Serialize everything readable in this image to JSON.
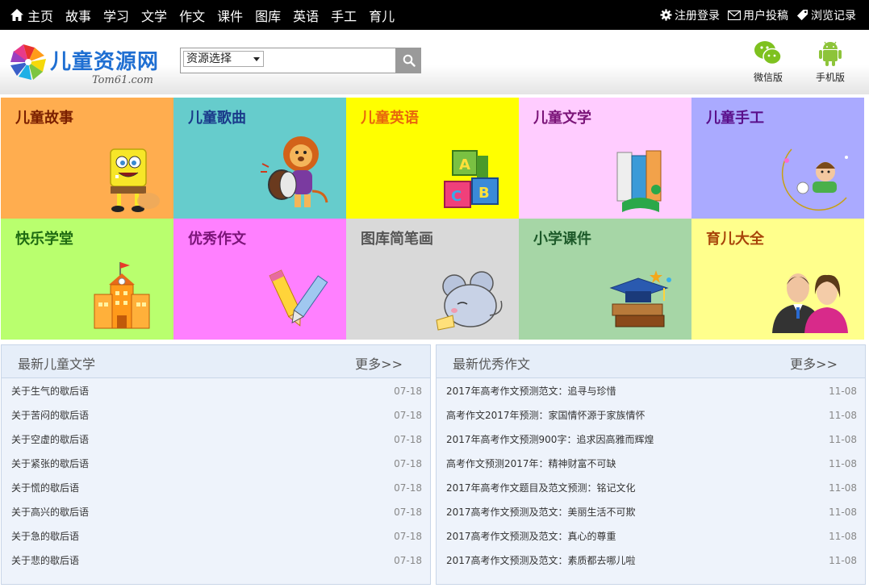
{
  "topnav": {
    "items": [
      "主页",
      "故事",
      "学习",
      "文学",
      "作文",
      "课件",
      "图库",
      "英语",
      "手工",
      "育儿"
    ],
    "right": [
      "注册登录",
      "用户投稿",
      "浏览记录"
    ]
  },
  "header": {
    "logo_text": "儿童资源网",
    "logo_sub": "Tom61.com",
    "search_select": "资源选择",
    "wechat_label": "微信版",
    "mobile_label": "手机版"
  },
  "tiles": [
    {
      "label": "儿童故事",
      "bg": "#ffad4f",
      "color": "#7a1f00"
    },
    {
      "label": "儿童歌曲",
      "bg": "#66cccc",
      "color": "#1a3a8a"
    },
    {
      "label": "儿童英语",
      "bg": "#ffff00",
      "color": "#e8670c"
    },
    {
      "label": "儿童文学",
      "bg": "#ffccff",
      "color": "#7a1478"
    },
    {
      "label": "儿童手工",
      "bg": "#aaaaff",
      "color": "#5a0f8a"
    },
    {
      "label": "快乐学堂",
      "bg": "#b9ff6e",
      "color": "#1f6b12"
    },
    {
      "label": "优秀作文",
      "bg": "#ff80ff",
      "color": "#7a1478"
    },
    {
      "label": "图库简笔画",
      "bg": "#d9d9d9",
      "color": "#555555"
    },
    {
      "label": "小学课件",
      "bg": "#a6d6a6",
      "color": "#1d5a2a"
    },
    {
      "label": "育儿大全",
      "bg": "#ffff8c",
      "color": "#a8450a"
    }
  ],
  "panel_left": {
    "title": "最新儿童文学",
    "more": "更多>>",
    "items": [
      {
        "title": "关于生气的歇后语",
        "date": "07-18"
      },
      {
        "title": "关于苦闷的歇后语",
        "date": "07-18"
      },
      {
        "title": "关于空虚的歇后语",
        "date": "07-18"
      },
      {
        "title": "关于紧张的歇后语",
        "date": "07-18"
      },
      {
        "title": "关于慌的歇后语",
        "date": "07-18"
      },
      {
        "title": "关于高兴的歇后语",
        "date": "07-18"
      },
      {
        "title": "关于急的歇后语",
        "date": "07-18"
      },
      {
        "title": "关于悲的歇后语",
        "date": "07-18"
      }
    ]
  },
  "panel_right": {
    "title": "最新优秀作文",
    "more": "更多>>",
    "items": [
      {
        "title": "2017年高考作文预测范文：追寻与珍惜",
        "date": "11-08"
      },
      {
        "title": "高考作文2017年预测：家国情怀源于家族情怀",
        "date": "11-08"
      },
      {
        "title": "2017年高考作文预测900字：追求因高雅而辉煌",
        "date": "11-08"
      },
      {
        "title": "高考作文预测2017年：精神财富不可缺",
        "date": "11-08"
      },
      {
        "title": "2017年高考作文题目及范文预测：铭记文化",
        "date": "11-08"
      },
      {
        "title": "2017高考作文预测及范文：美丽生活不可欺",
        "date": "11-08"
      },
      {
        "title": "2017高考作文预测及范文：真心的尊重",
        "date": "11-08"
      },
      {
        "title": "2017高考作文预测及范文：素质都去哪儿啦",
        "date": "11-08"
      }
    ]
  }
}
